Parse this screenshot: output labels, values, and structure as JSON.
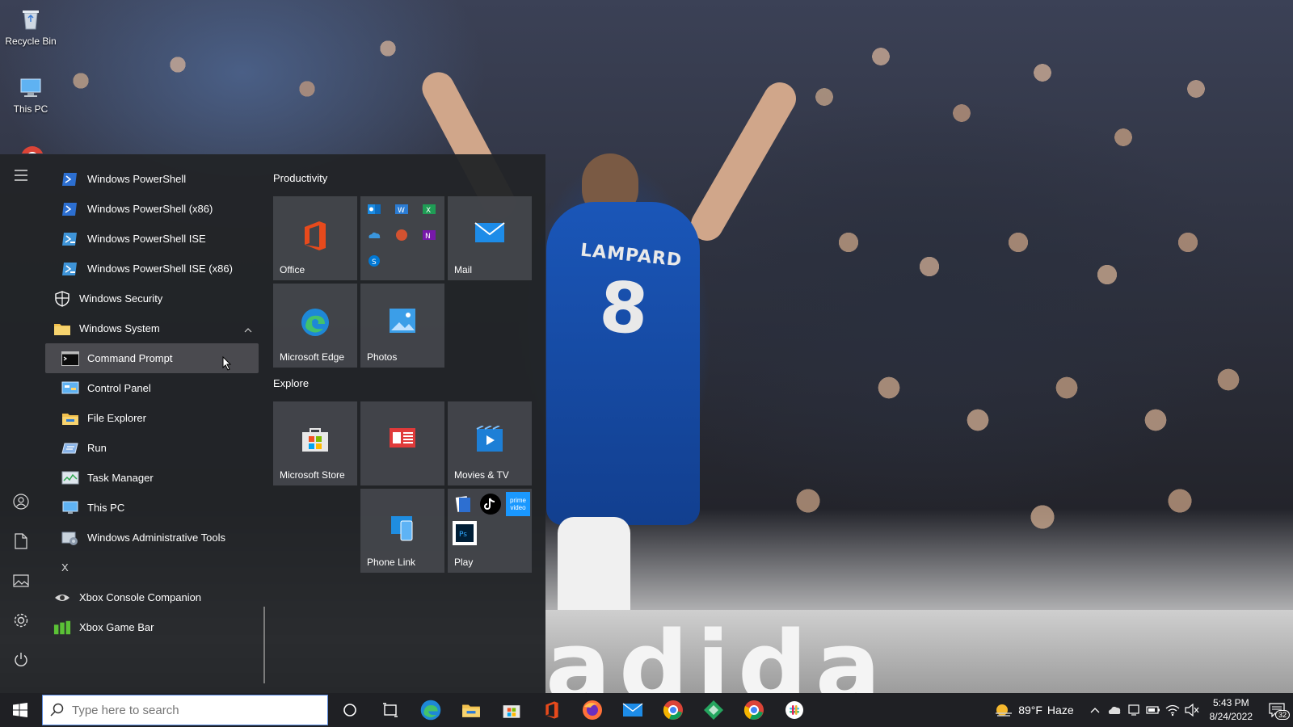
{
  "desktop": {
    "icons": [
      {
        "label": "Recycle Bin"
      },
      {
        "label": "This PC"
      }
    ],
    "wallpaper": {
      "player_name": "LAMPARD",
      "player_number": "8",
      "board_text": "adida"
    }
  },
  "start_menu": {
    "apps": [
      {
        "label": "Windows PowerShell",
        "icon": "powershell-icon"
      },
      {
        "label": "Windows PowerShell (x86)",
        "icon": "powershell-icon"
      },
      {
        "label": "Windows PowerShell ISE",
        "icon": "powershell-ise-icon"
      },
      {
        "label": "Windows PowerShell ISE (x86)",
        "icon": "powershell-ise-icon"
      },
      {
        "label": "Windows Security",
        "icon": "shield-icon"
      },
      {
        "label": "Windows System",
        "icon": "folder-icon"
      },
      {
        "label": "Command Prompt",
        "icon": "cmd-icon"
      },
      {
        "label": "Control Panel",
        "icon": "control-panel-icon"
      },
      {
        "label": "File Explorer",
        "icon": "folder-icon"
      },
      {
        "label": "Run",
        "icon": "run-icon"
      },
      {
        "label": "Task Manager",
        "icon": "task-manager-icon"
      },
      {
        "label": "This PC",
        "icon": "computer-icon"
      },
      {
        "label": "Windows Administrative Tools",
        "icon": "admin-tools-icon"
      },
      {
        "label": "X"
      },
      {
        "label": "Xbox Console Companion",
        "icon": "xbox-icon"
      },
      {
        "label": "Xbox Game Bar",
        "icon": "xbox-game-bar-icon"
      }
    ],
    "sections": {
      "productivity": "Productivity",
      "explore": "Explore"
    },
    "tiles": {
      "office": "Office",
      "mail": "Mail",
      "edge": "Microsoft Edge",
      "photos": "Photos",
      "store": "Microsoft Store",
      "movies": "Movies & TV",
      "phone_link": "Phone Link",
      "play": "Play",
      "play_prime": "prime video"
    }
  },
  "taskbar": {
    "search_placeholder": "Type here to search",
    "weather": {
      "temp": "89°F",
      "condition": "Haze"
    },
    "clock": {
      "time": "5:43 PM",
      "date": "8/24/2022"
    },
    "notification_count": "32"
  },
  "colors": {
    "accent": "#0078d4",
    "start_bg": "#222428",
    "tile_bg": "#44464c",
    "taskbar_bg": "#1f2024"
  }
}
